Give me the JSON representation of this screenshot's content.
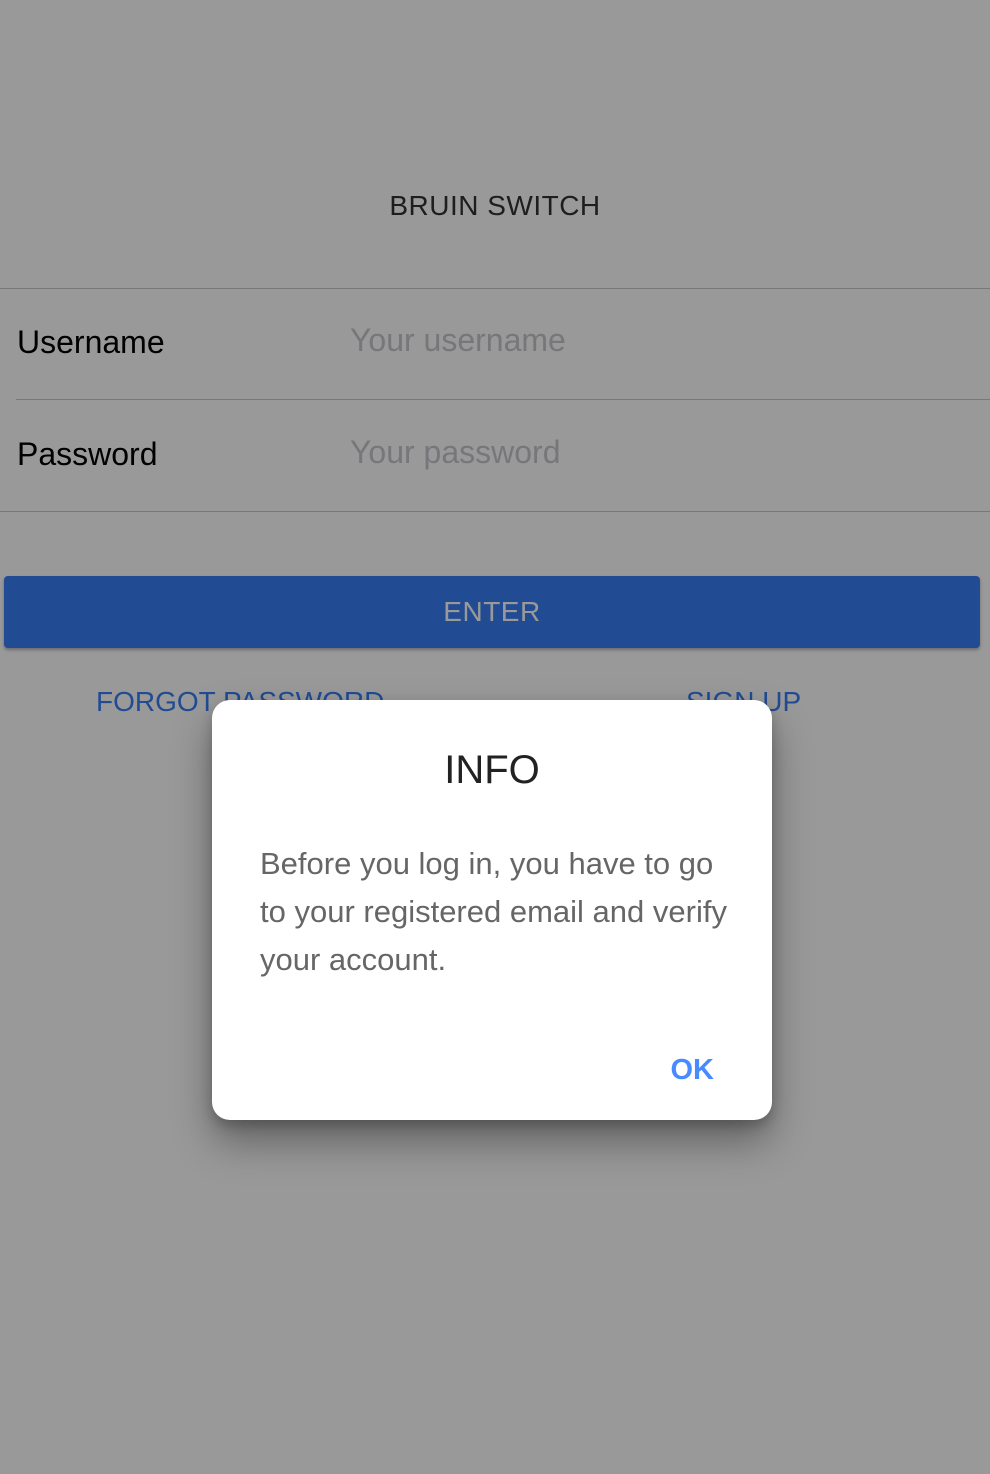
{
  "header": {
    "title": "BRUIN SWITCH"
  },
  "login_form": {
    "username": {
      "label": "Username",
      "placeholder": "Your username",
      "value": ""
    },
    "password": {
      "label": "Password",
      "placeholder": "Your password",
      "value": ""
    },
    "enter_label": "ENTER",
    "forgot_label": "FORGOT PASSWORD",
    "signup_label": "SIGN UP"
  },
  "alert": {
    "title": "INFO",
    "message": "Before you log in, you have to go to your registered email and verify your account.",
    "ok_label": "OK"
  },
  "colors": {
    "primary": "#387ef5",
    "alert_button": "#488aff",
    "backdrop": "rgba(0,0,0,0.4)"
  }
}
